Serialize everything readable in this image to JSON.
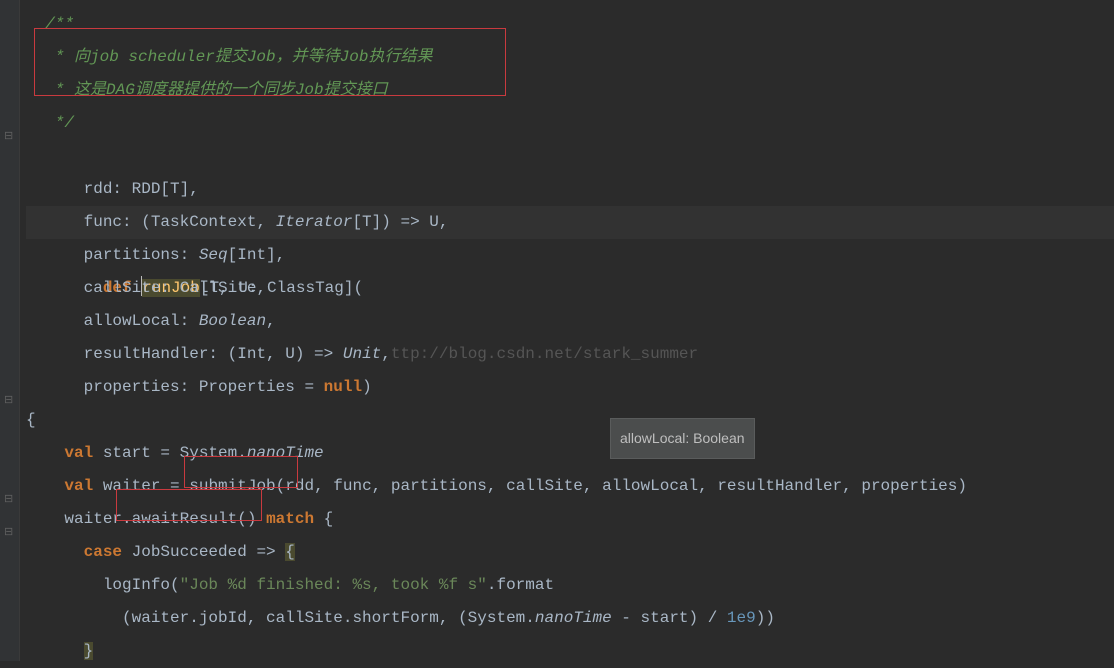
{
  "code": {
    "comment_open": "/**",
    "comment_l1": " * 向job scheduler提交Job，并等待Job执行结果",
    "comment_l2": " * 这是DAG调度器提供的一个同步Job提交接口",
    "comment_close": " */",
    "def": "def",
    "runJob": "runJob",
    "sig_open": "[T, U: ClassTag](",
    "p_rdd": "rdd: RDD[T],",
    "p_func_pre": "func: (TaskContext, ",
    "p_func_iter": "Iterator",
    "p_func_post": "[T]) => U,",
    "p_partitions_pre": "partitions: ",
    "p_partitions_seq": "Seq",
    "p_partitions_int": "Int",
    "p_partitions_close": "],",
    "p_callsite": "callSite: CallSite,",
    "p_allow_pre": "allowLocal: ",
    "p_allow_type": "Boolean",
    "p_allow_post": ",",
    "p_result_pre": "resultHandler: (",
    "p_result_int": "Int",
    "p_result_mid": ", U) => ",
    "p_result_unit": "Unit",
    "p_result_post": ",",
    "watermark": "ttp://blog.csdn.net/stark_summer",
    "p_props_pre": "properties: Properties = ",
    "p_props_null": "null",
    "p_props_close": ")",
    "brace_open": "{",
    "val1": "val",
    "start_eq": " start = System.",
    "nanoTime": "nanoTime",
    "val2": "val",
    "waiter_eq": " waiter = ",
    "submitJob": "submitJob",
    "submit_args": "(rdd, func, partitions, callSite, allowLocal, resultHandler, properties)",
    "waiter_dot": "waiter.",
    "awaitResult": "awaitResult",
    "await_args": "() ",
    "match": "match",
    "match_brace": " {",
    "case": "case",
    "jobsucc": " JobSucceeded => ",
    "case_brace": "{",
    "loginfo": "logInfo(",
    "str1": "\"Job %d finished: %s, took %f s\"",
    "format": ".format",
    "format_args_pre": "(waiter.jobId, callSite.shortForm, (System.",
    "nanoTime2": "nanoTime",
    "format_args_mid": " - start) / ",
    "e9": "1e9",
    "format_close": "))",
    "close_brace": "}"
  },
  "tooltip": {
    "text": "allowLocal: Boolean"
  },
  "indent": {
    "i1": "  ",
    "i2": "    ",
    "i3": "      ",
    "i4": "        ",
    "i5": "          "
  }
}
